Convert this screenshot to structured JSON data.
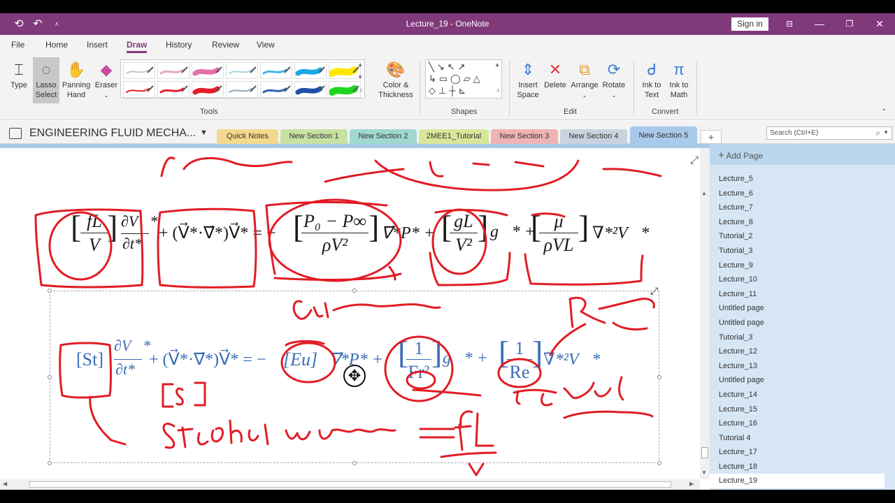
{
  "window": {
    "title": "Lecture_19  -  OneNote",
    "sign_in": "Sign in"
  },
  "menu": [
    "File",
    "Home",
    "Insert",
    "Draw",
    "History",
    "Review",
    "View"
  ],
  "ribbon": {
    "type": "Type",
    "lasso_1": "Lasso",
    "lasso_2": "Select",
    "panning_1": "Panning",
    "panning_2": "Hand",
    "eraser": "Eraser",
    "color_1": "Color &",
    "color_2": "Thickness",
    "tools_label": "Tools",
    "shapes_label": "Shapes",
    "insert_space_1": "Insert",
    "insert_space_2": "Space",
    "delete": "Delete",
    "arrange": "Arrange",
    "rotate": "Rotate",
    "edit_label": "Edit",
    "ink_text_1": "Ink to",
    "ink_text_2": "Text",
    "ink_math_1": "Ink to",
    "ink_math_2": "Math",
    "convert_label": "Convert",
    "pen_colors": [
      "#c9c9c9",
      "#e7a7c7",
      "#e56fa9",
      "#a7d4e6",
      "#3fb6e8",
      "#18a8e6",
      "#ffe600",
      "#e5202a",
      "#e5202a",
      "#e5202a",
      "#8aa7c4",
      "#2b64b8",
      "#1f4fa8",
      "#1fd61f"
    ]
  },
  "notebook": {
    "name": "ENGINEERING FLUID MECHA...",
    "tabs": [
      {
        "label": "Quick Notes",
        "color": "#f4d98c"
      },
      {
        "label": "New Section 1",
        "color": "#c7e1a2"
      },
      {
        "label": "New Section 2",
        "color": "#9fd8cf"
      },
      {
        "label": "2MEE1_Tutorial",
        "color": "#d8e69a"
      },
      {
        "label": "New Section 3",
        "color": "#efb3b3"
      },
      {
        "label": "New Section 4",
        "color": "#c9d3df"
      },
      {
        "label": "New Section 5",
        "color": "#a9c9ea"
      }
    ],
    "add_tab": "+",
    "search_placeholder": "Search (Ctrl+E)"
  },
  "pages": {
    "add_page": "Add Page",
    "items": [
      "Lecture_5",
      "Lecture_6",
      "Lecture_7",
      "Lecture_8",
      "Tutorial_2",
      "Tutorial_3",
      "Lecture_9",
      "Lecture_10",
      "Lecture_11",
      "Untitled page",
      "Untitled page",
      "Tutorial_3",
      "Lecture_12",
      "Lecture_13",
      "Untitled page",
      "Lecture_14",
      "Lecture_15",
      "Lecture_16",
      "Tutorial 4",
      "Lecture_17",
      "Lecture_18",
      "Lecture_19"
    ],
    "current_index": 21
  },
  "content": {
    "eq1": {
      "t1_num": "fL",
      "t1_den": "V",
      "d_num": "∂V⃗*",
      "d_den": "∂t*",
      "adv": "+ (V⃗*·∇⃗*)V⃗* = −",
      "p_num": "P₀ − P∞",
      "p_den": "ρV²",
      "grad": "∇⃗*P* +",
      "g_num": "gL",
      "g_den": "V²",
      "g_vec": "g⃗* +",
      "mu_num": "μ",
      "mu_den": "ρVL",
      "visc": "∇*²V⃗*"
    },
    "eq2": {
      "st": "[St]",
      "d_num": "∂V⃗*",
      "d_den": "∂t*",
      "adv": "+ (V⃗*·∇⃗*)V⃗* = −",
      "eu": "[Eu]",
      "grad": "∇⃗*P* +",
      "fr_num": "1",
      "fr_den": "Fr²",
      "g_vec": "g⃗* +",
      "re_num": "1",
      "re_den": "Re",
      "visc": "∇*²V⃗*"
    }
  }
}
